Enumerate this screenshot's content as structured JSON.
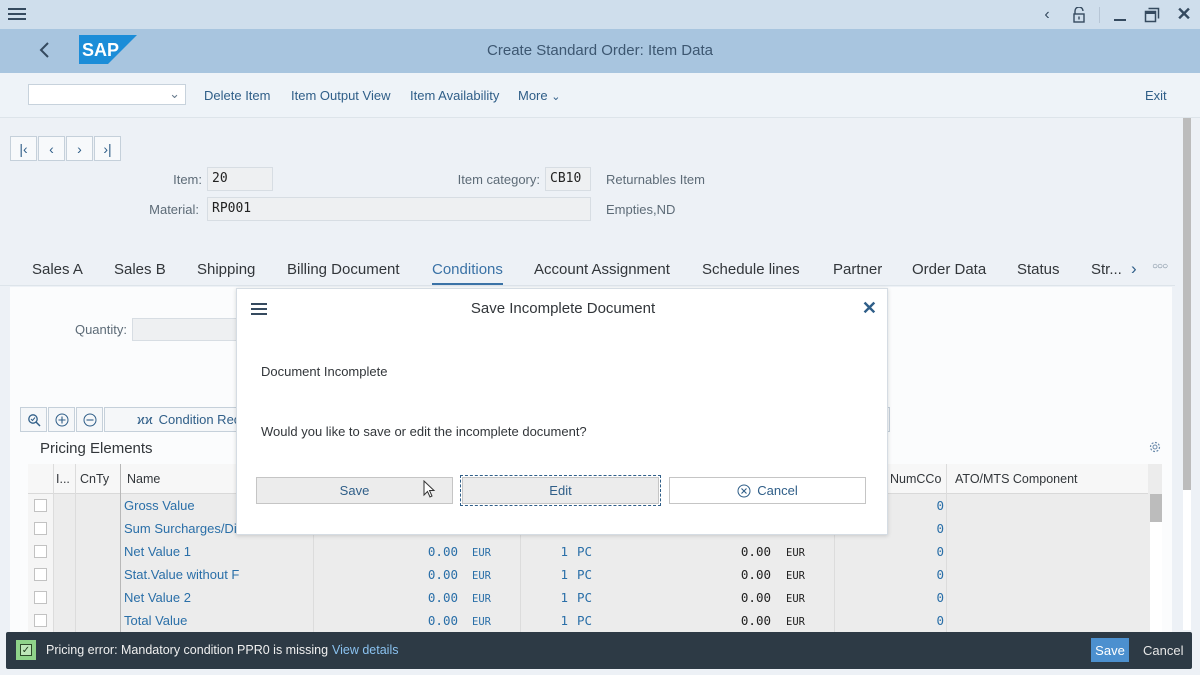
{
  "window": {
    "controls": [
      "chevron-left",
      "unlock",
      "minimize",
      "restore",
      "close"
    ]
  },
  "shell": {
    "title": "Create Standard Order: Item Data",
    "logo_text": "SAP"
  },
  "toolbar": {
    "select_value": "",
    "buttons": [
      "Delete Item",
      "Item Output View",
      "Item Availability",
      "More"
    ],
    "exit_label": "Exit"
  },
  "header": {
    "item_label": "Item:",
    "item_value": "20",
    "item_category_label": "Item category:",
    "item_category_value": "CB10",
    "item_category_desc": "Returnables Item",
    "material_label": "Material:",
    "material_value": "RP001",
    "material_desc": "Empties,ND"
  },
  "tabs": [
    "Sales A",
    "Sales B",
    "Shipping",
    "Billing Document",
    "Conditions",
    "Account Assignment",
    "Schedule lines",
    "Partner",
    "Order Data",
    "Status",
    "Str..."
  ],
  "active_tab": "Conditions",
  "conditions": {
    "quantity_label": "Quantity:",
    "quantity_value": "",
    "condition_record_label": "Condition Reco",
    "pricing_title": "Pricing Elements",
    "columns": [
      "I...",
      "CnTy",
      "Name",
      "NumCCo",
      "ATO/MTS Component"
    ],
    "rows": [
      {
        "name": "Gross Value",
        "amount": "",
        "currency": "",
        "per": "",
        "uom": "",
        "cond_value": "",
        "cond_curr": "",
        "numcco": "0"
      },
      {
        "name": "Sum Surcharges/Di",
        "amount": "",
        "currency": "",
        "per": "",
        "uom": "",
        "cond_value": "",
        "cond_curr": "",
        "numcco": "0"
      },
      {
        "name": "Net Value 1",
        "amount": "0.00",
        "currency": "EUR",
        "per": "1",
        "uom": "PC",
        "cond_value": "0.00",
        "cond_curr": "EUR",
        "numcco": "0"
      },
      {
        "name": "Stat.Value without F",
        "amount": "0.00",
        "currency": "EUR",
        "per": "1",
        "uom": "PC",
        "cond_value": "0.00",
        "cond_curr": "EUR",
        "numcco": "0"
      },
      {
        "name": "Net Value 2",
        "amount": "0.00",
        "currency": "EUR",
        "per": "1",
        "uom": "PC",
        "cond_value": "0.00",
        "cond_curr": "EUR",
        "numcco": "0"
      },
      {
        "name": "Total Value",
        "amount": "0.00",
        "currency": "EUR",
        "per": "1",
        "uom": "PC",
        "cond_value": "0.00",
        "cond_curr": "EUR",
        "numcco": "0"
      }
    ]
  },
  "dialog": {
    "title": "Save Incomplete Document",
    "text1": "Document Incomplete",
    "text2": "Would you like to save or edit the incomplete document?",
    "save_label": "Save",
    "edit_label": "Edit",
    "cancel_label": "Cancel"
  },
  "message_bar": {
    "text": "Pricing error: Mandatory condition PPR0 is missing",
    "link": "View details",
    "save_label": "Save",
    "cancel_label": "Cancel",
    "status_color": "#8fd38a"
  },
  "colors": {
    "shell": "#a8c5df",
    "accent": "#3a72a6",
    "link": "#2a6fa8",
    "message_bar": "#2d3a45",
    "primary_button": "#4c90cf"
  }
}
